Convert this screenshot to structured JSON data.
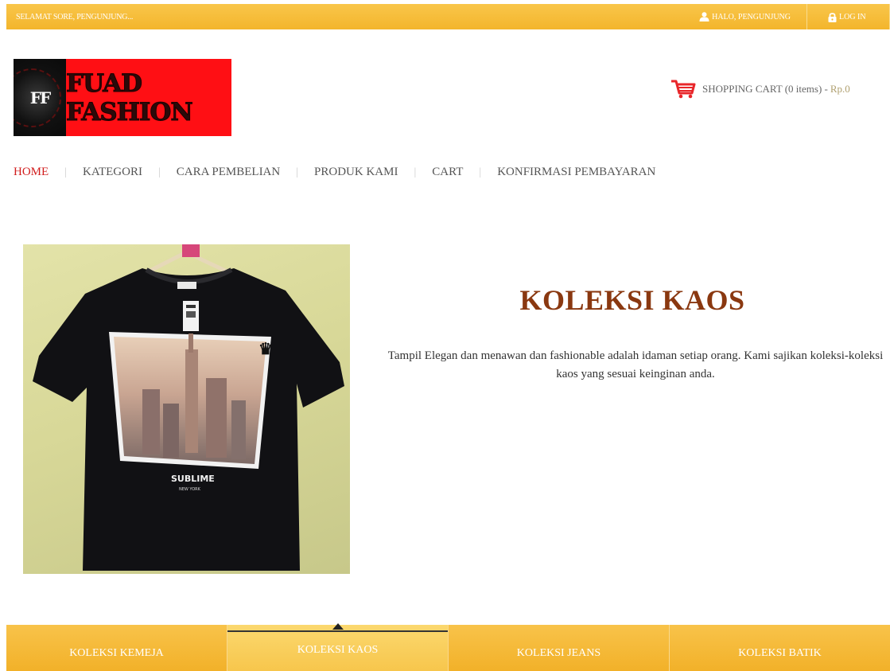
{
  "topbar": {
    "greeting": "SELAMAT SORE, PENGUNJUNG...",
    "user_label": "HALO,  PENGUNJUNG",
    "login_label": "LOG IN",
    "color": "#f3b52c"
  },
  "logo": {
    "monogram": "FF",
    "text": "FUAD FASHION",
    "bg_color": "#ff0f14"
  },
  "cart": {
    "label": "SHOPPING CART (0 items) - ",
    "amount": "Rp.0",
    "icon": "shopping-cart-icon",
    "icon_color": "#e8262a"
  },
  "nav": {
    "items": [
      {
        "label": "HOME",
        "active": true
      },
      {
        "label": "KATEGORI"
      },
      {
        "label": "CARA PEMBELIAN"
      },
      {
        "label": "PRODUK KAMI"
      },
      {
        "label": "CART"
      },
      {
        "label": "KONFIRMASI PEMBAYARAN"
      }
    ],
    "active_color": "#d11c1c"
  },
  "hero": {
    "title": "KOLEKSI KAOS",
    "description": "Tampil Elegan dan menawan dan fashionable adalah idaman setiap orang. Kami sajikan koleksi-koleksi kaos yang sesuai keinginan anda.",
    "image": {
      "shirt_print_line1": "SUBLIME",
      "shirt_print_line2": "NEW YORK"
    },
    "title_color": "#8a3810"
  },
  "bottom_tabs": [
    {
      "label": "KOLEKSI KEMEJA"
    },
    {
      "label": "KOLEKSI KAOS",
      "active": true
    },
    {
      "label": "KOLEKSI JEANS"
    },
    {
      "label": "KOLEKSI BATIK"
    }
  ]
}
